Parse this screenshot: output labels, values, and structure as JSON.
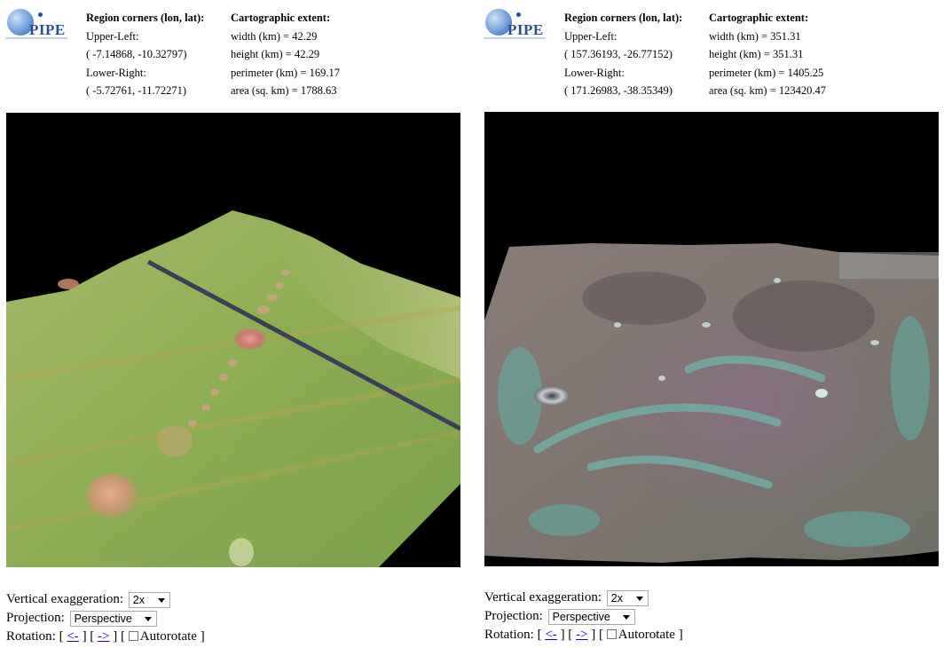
{
  "panels": [
    {
      "logo_text": "PIPE",
      "region": {
        "heading": "Region corners (lon, lat):",
        "upper_left_label": "Upper-Left:",
        "upper_left_value": "( -7.14868, -10.32797)",
        "lower_right_label": "Lower-Right:",
        "lower_right_value": "( -5.72761, -11.72271)"
      },
      "extent": {
        "heading": "Cartographic extent:",
        "width": "width (km) = 42.29",
        "height": "height (km) = 42.29",
        "perimeter": "perimeter (km) = 169.17",
        "area": "area (sq. km) = 1788.63"
      },
      "controls": {
        "vertical_exaggeration_label": "Vertical exaggeration:",
        "vertical_exaggeration_value": "2x",
        "projection_label": "Projection:",
        "projection_value": "Perspective",
        "rotation_label": "Rotation:",
        "rotate_left": "<-",
        "rotate_right": "->",
        "autorotate_label": "Autorotate",
        "autorotate_checked": false
      },
      "view_colors": {
        "background": "#000000",
        "terrain": "#8aa84e",
        "track": "#3a3f55"
      }
    },
    {
      "logo_text": "PIPE",
      "region": {
        "heading": "Region corners (lon, lat):",
        "upper_left_label": "Upper-Left:",
        "upper_left_value": "( 157.36193, -26.77152)",
        "lower_right_label": "Lower-Right:",
        "lower_right_value": "( 171.26983, -38.35349)"
      },
      "extent": {
        "heading": "Cartographic extent:",
        "width": "width (km) = 351.31",
        "height": "height (km) = 351.31",
        "perimeter": "perimeter (km) = 1405.25",
        "area": "area (sq. km) = 123420.47"
      },
      "controls": {
        "vertical_exaggeration_label": "Vertical exaggeration:",
        "vertical_exaggeration_value": "2x",
        "projection_label": "Projection:",
        "projection_value": "Perspective",
        "rotation_label": "Rotation:",
        "rotate_left": "<-",
        "rotate_right": "->",
        "autorotate_label": "Autorotate",
        "autorotate_checked": false
      },
      "view_colors": {
        "background": "#000000",
        "terrain": "#7b6f6a",
        "highland": "#6fb6a8"
      }
    }
  ]
}
